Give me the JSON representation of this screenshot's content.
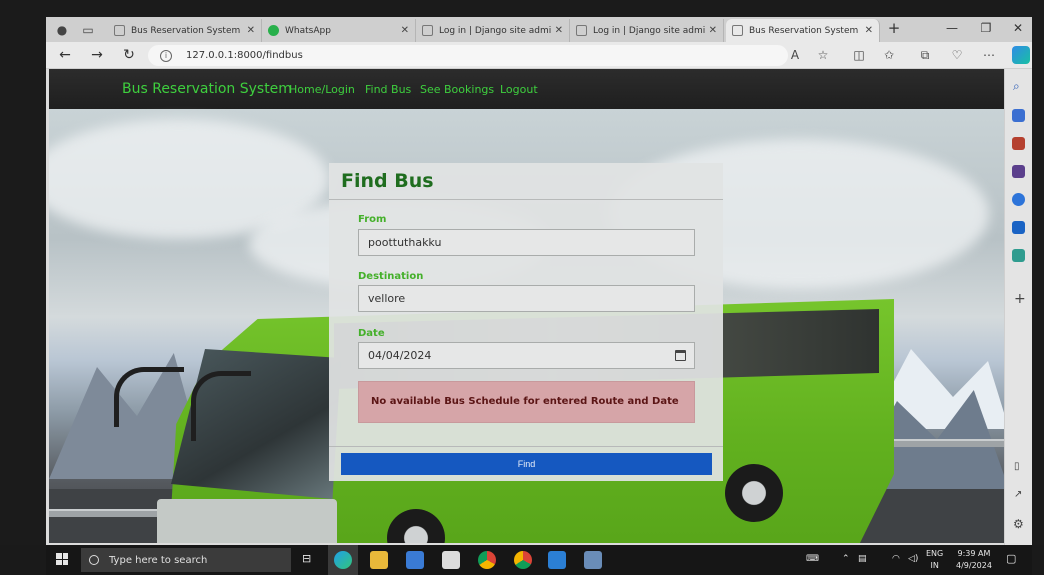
{
  "browser": {
    "tabs": [
      {
        "title": "Bus Reservation System in Dj",
        "favicon": "page-icon",
        "active": false
      },
      {
        "title": "WhatsApp",
        "favicon": "whatsapp-icon",
        "active": false
      },
      {
        "title": "Log in | Django site admin",
        "favicon": "page-icon",
        "active": false
      },
      {
        "title": "Log in | Django site admin",
        "favicon": "page-icon",
        "active": false
      },
      {
        "title": "Bus Reservation System in Dj",
        "favicon": "page-icon",
        "active": true
      }
    ],
    "close_glyph": "✕",
    "new_tab_glyph": "+",
    "url": "127.0.0.1:8000/findbus"
  },
  "site": {
    "brand": "Bus Reservation System",
    "nav": [
      "Home/Login",
      "Find Bus",
      "See Bookings",
      "Logout"
    ]
  },
  "form": {
    "title": "Find Bus",
    "from_label": "From",
    "from_value": "poottuthakku",
    "destination_label": "Destination",
    "destination_value": "vellore",
    "date_label": "Date",
    "date_value": "04/04/2024",
    "alert": "No available Bus Schedule for entered Route and Date",
    "submit": "Find"
  },
  "taskbar": {
    "search_placeholder": "Type here to search",
    "lang_line1": "ENG",
    "lang_line2": "IN",
    "time": "9:39 AM",
    "date": "4/9/2024"
  },
  "colors": {
    "accent_green": "#3ecf3e",
    "title_green": "#1f6d1f",
    "button_blue": "#1558c0",
    "alert_bg": "#d6a5a8"
  }
}
